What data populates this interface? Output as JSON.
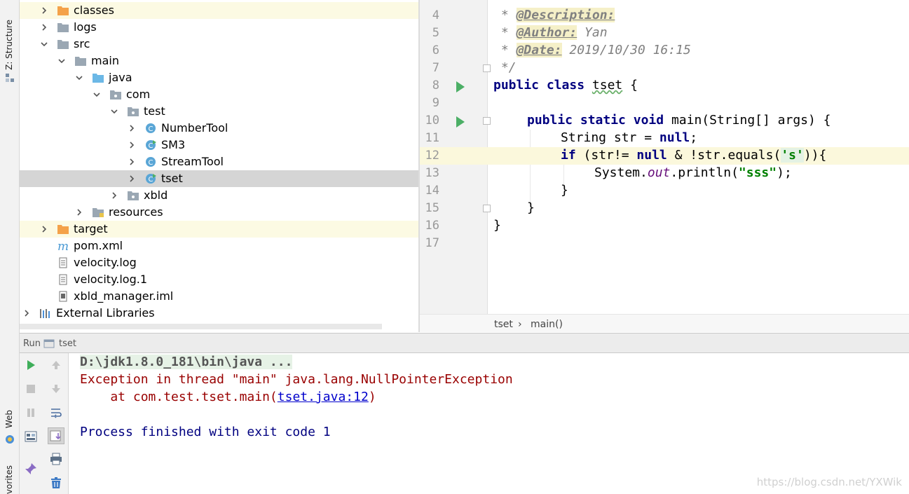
{
  "side_tabs": {
    "structure": "Z: Structure",
    "web": "Web",
    "favorites": "vorites"
  },
  "tree": {
    "items": [
      {
        "label": "classes"
      },
      {
        "label": "logs"
      },
      {
        "label": "src"
      },
      {
        "label": "main"
      },
      {
        "label": "java"
      },
      {
        "label": "com"
      },
      {
        "label": "test"
      },
      {
        "label": "NumberTool"
      },
      {
        "label": "SM3"
      },
      {
        "label": "StreamTool"
      },
      {
        "label": "tset"
      },
      {
        "label": "xbld"
      },
      {
        "label": "resources"
      },
      {
        "label": "target"
      },
      {
        "label": "pom.xml"
      },
      {
        "label": "velocity.log"
      },
      {
        "label": "velocity.log.1"
      },
      {
        "label": "xbld_manager.iml"
      },
      {
        "label": "External Libraries"
      }
    ]
  },
  "editor": {
    "line_numbers": [
      "4",
      "5",
      "6",
      "7",
      "8",
      "9",
      "10",
      "11",
      "12",
      "13",
      "14",
      "15",
      "16",
      "17"
    ],
    "comment_prefix": " * ",
    "desc_tag": "@Description:",
    "author_tag": "@Author:",
    "author_value": " Yan",
    "date_tag": "@Date:",
    "date_value": " 2019/10/30 16:15",
    "comment_end": " */",
    "kw_public": "public",
    "kw_class": "class",
    "kw_static": "static",
    "kw_void": "void",
    "kw_null": "null",
    "kw_if": "if",
    "class_name": "tset",
    "brace_open": " {",
    "main_sig": " main(String[] args) {",
    "str_decl": "String str = ",
    "semicolon": ";",
    "if_part1": " (str!= ",
    "if_part2": " & !str.equals(",
    "char_lit": "'s'",
    "if_end": ")){",
    "sysout1": "System.",
    "sysout_field": "out",
    "sysout2": ".println(",
    "str_lit": "\"sss\"",
    "sysout_end": ");",
    "brace_close": "}"
  },
  "breadcrumbs": {
    "class": "tset",
    "separator": "›",
    "method": "main()"
  },
  "run_panel": {
    "title": "Run",
    "config": "tset"
  },
  "console": {
    "cmd": "D:\\jdk1.8.0_181\\bin\\java ...",
    "exception": "Exception in thread \"main\" java.lang.NullPointerException",
    "at_prefix": "    at com.test.tset.main(",
    "link": "tset.java:12",
    "at_suffix": ")",
    "finished": "Process finished with exit code 1"
  },
  "watermark": "https://blog.csdn.net/YXWik"
}
